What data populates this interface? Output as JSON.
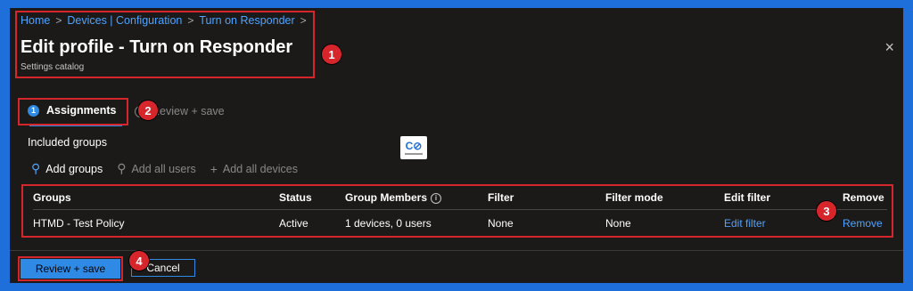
{
  "breadcrumb": [
    "Home",
    "Devices | Configuration",
    "Turn on Responder"
  ],
  "breadcrumb_sep": ">",
  "title": "Edit profile - Turn on Responder",
  "subtitle": "Settings catalog",
  "close_icon": "×",
  "tabs": {
    "assignments": {
      "step": "1",
      "label": "Assignments"
    },
    "review": {
      "label": "Review + save"
    }
  },
  "included_groups_label": "Included groups",
  "logo_text": "C⊘",
  "actions": {
    "add_groups": "Add groups",
    "add_all_users": "Add all users",
    "add_all_devices": "Add all devices"
  },
  "table": {
    "columns": [
      "Groups",
      "Status",
      "Group Members",
      "Filter",
      "Filter mode",
      "Edit filter",
      "Remove"
    ],
    "rows": [
      {
        "group": "HTMD - Test Policy",
        "status": "Active",
        "members": "1 devices, 0 users",
        "filter": "None",
        "filter_mode": "None",
        "edit_filter": "Edit filter",
        "remove": "Remove"
      }
    ]
  },
  "buttons": {
    "review_save": "Review + save",
    "cancel": "Cancel"
  },
  "annotations": [
    "1",
    "2",
    "3",
    "4"
  ],
  "colors": {
    "background": "#1b1a19",
    "accent": "#2f8ae6",
    "link": "#4ea3ff",
    "callout": "#d7262b",
    "frame": "#1e6fd9"
  }
}
